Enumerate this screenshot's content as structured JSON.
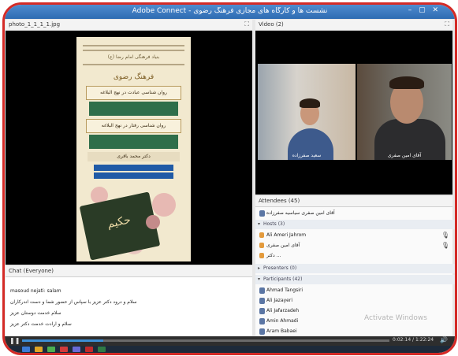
{
  "window": {
    "title": "Adobe Connect - نشست ها و کارگاه های مجازی فرهنگ رضوی",
    "controls": "– ▢ ✕"
  },
  "share_pod": {
    "label": "photo_1_1_1_1.jpg",
    "controls": "⛶"
  },
  "poster": {
    "subtitle": "بنیاد فرهنگی امام رضا (ع)",
    "heading": "فرهنگ رضوی",
    "band1": "روان شناسی عبادت در نهج البلاغه",
    "band2": "روان شناسی رفتار در نهج البلاغه",
    "speakers": "دکتر محمد باقری",
    "book_title": "حکیم"
  },
  "video_pod": {
    "label": "Video (2)",
    "controls": "⛶",
    "cameras": [
      {
        "name": "سعید صفرزاده"
      },
      {
        "name": "آقای امین صفری"
      }
    ]
  },
  "attendees_pod": {
    "label": "Attendees (45)",
    "rows": [
      {
        "type": "user",
        "text": "آقای امین صفری سیاسیه صفرزاده"
      },
      {
        "type": "section",
        "text": "Hosts (3)"
      },
      {
        "type": "host",
        "text": "Ali Ameri Jahrom"
      },
      {
        "type": "host",
        "text": "آقای امین صفری"
      },
      {
        "type": "host",
        "text": "دکتر ..."
      },
      {
        "type": "section",
        "text": "Presenters (0)"
      },
      {
        "type": "section",
        "text": "Participants (42)"
      },
      {
        "type": "participant",
        "text": "Ahmad Tangsiri"
      },
      {
        "type": "participant",
        "text": "Ali Jazayeri"
      },
      {
        "type": "participant",
        "text": "Ali Jafarzadeh"
      },
      {
        "type": "participant",
        "text": "Amin Ahmadi"
      },
      {
        "type": "participant",
        "text": "Aram Babaei"
      }
    ]
  },
  "watermark": {
    "text": "Activate Windows"
  },
  "chat_pod": {
    "label": "Chat (Everyone)",
    "messages": [
      "masoud nejati: salam",
      "سلام و درود دکتر عزیز با سپاس از حضور شما و دست اندرکاران",
      "سلام خدمت دوستان عزیز",
      "سلام و ارادت خدمت دکتر عزیز"
    ]
  },
  "playback": {
    "progress": 0.22,
    "time": "0:02:14 / 1:22:24"
  },
  "colors": {
    "border": "#d42b27",
    "titlebar": "#2e6bb2",
    "pod_black": "#000000"
  }
}
